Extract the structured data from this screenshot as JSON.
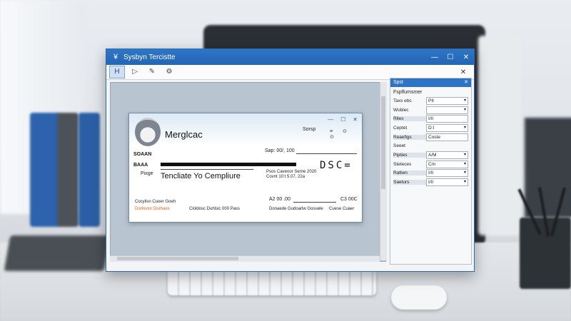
{
  "window": {
    "title": "Sysbyn Tercistte",
    "controls": [
      "—",
      "☐",
      "✕"
    ]
  },
  "toolbar": {
    "buttons": [
      "H",
      "▷",
      "✎",
      "⚙"
    ],
    "close": "✕"
  },
  "check": {
    "company": "Merglcac",
    "controls": [
      "—",
      "☐",
      "✕"
    ],
    "header_right": "Sorsp",
    "date_label": "Sap: 00/, 100",
    "left_labels": [
      "SOAAN",
      "BAAA",
      "Pixge"
    ],
    "payee": "Tencliate Yo Cempliure",
    "amount_big": "DSC=",
    "amount_text": "Psos Cavenor Serne 2020",
    "amount_text2": "Covnt 10:t 5.07, 22a",
    "sig_date": "A2 00 .00",
    "sig_right": "C3 00C",
    "footer_left_1": "Cocylisn Cuoer Goeh",
    "footer_left_2": "Dorlostor Dorhaes",
    "footer_left_3": "Cloldosc Duhlsic 000 Pass",
    "footer_right_1": "Donaede Gudoarlw Gosuele",
    "footer_right_2": "Cuese Cuaer"
  },
  "panel": {
    "title": "Spst",
    "subtitle": "Fsplfumsmer",
    "rows": [
      {
        "key": "Taxs ebc",
        "value": "PII"
      },
      {
        "key": "Woblec",
        "value": ""
      },
      {
        "key": "Rlles",
        "value": "I/II"
      },
      {
        "key": "Ceptet",
        "value": "D:I"
      },
      {
        "key": "Reaefigs",
        "value": "Coste"
      },
      {
        "key": "Seeet",
        "value": ""
      },
      {
        "key": "Pipties",
        "value": "A/M"
      },
      {
        "key": "Steteces",
        "value": "Cm"
      },
      {
        "key": "Ratlwn",
        "value": "I/II"
      },
      {
        "key": "Saeturs",
        "value": "I/II"
      }
    ]
  },
  "colors": {
    "titlebar": "#2a6fc0",
    "accent": "#2f73c4",
    "orange": "#d9631c"
  }
}
